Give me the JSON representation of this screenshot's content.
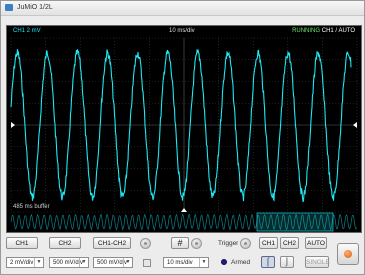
{
  "window": {
    "title": "JuMiO 1/2L"
  },
  "colors": {
    "trace": "#1ee7f2",
    "background": "#000000",
    "running": "#74e36c",
    "grid": "#3a3a3a"
  },
  "screen": {
    "ch_scale": "CH1 2 mV",
    "timebase": "10 ms/div",
    "status": "RUNNING",
    "trigger_info": "CH1",
    "trigger_slope_glyph": "/",
    "trigger_mode": "AUTO",
    "buffer": "485 ms buffer"
  },
  "controls": {
    "ch1_label": "CH1",
    "ch2_label": "CH2",
    "ch1_ch2_label": "CH1-CH2",
    "ch1_scale": "2 mV/div",
    "ch2_scale": "500 mV/div",
    "math_scale": "500 mV/div",
    "timebase_combo": "10 ms/div",
    "trigger_label": "Trigger",
    "trigger_ch1": "CH1",
    "trigger_ch2": "CH2",
    "auto_label": "AUTO",
    "armed_label": "Armed",
    "single_label": "SINGLE"
  },
  "icons": {
    "app": "scope-app-icon",
    "grid": "grid-icon",
    "rising_edge": "rising-edge-icon",
    "falling_edge": "falling-edge-icon",
    "power": "power-icon"
  }
}
